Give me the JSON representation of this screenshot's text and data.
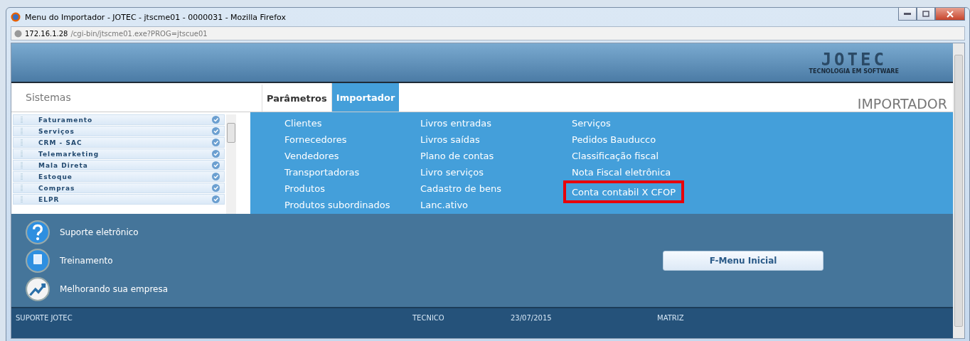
{
  "window": {
    "title": "Menu do Importador - JOTEC - jtscme01 - 0000031 - Mozilla Firefox"
  },
  "address": {
    "host": "172.16.1.28",
    "path": "/cgi-bin/jtscme01.exe?PROG=jtscue01"
  },
  "logo": {
    "name": "JOTEC",
    "tagline": "TECNOLOGIA EM SOFTWARE"
  },
  "sidebar": {
    "title": "Sistemas",
    "items": [
      {
        "label": "Faturamento"
      },
      {
        "label": "Serviços"
      },
      {
        "label": "CRM - SAC"
      },
      {
        "label": "Telemarketing"
      },
      {
        "label": "Mala Direta"
      },
      {
        "label": "Estoque"
      },
      {
        "label": "Compras"
      },
      {
        "label": "ELPR"
      }
    ]
  },
  "tabs": [
    {
      "label": "Parâmetros",
      "selected": false
    },
    {
      "label": "Importador",
      "selected": true
    }
  ],
  "page_title": "IMPORTADOR",
  "menu_columns": [
    [
      {
        "label": "Clientes",
        "highlighted": false
      },
      {
        "label": "Fornecedores",
        "highlighted": false
      },
      {
        "label": "Vendedores",
        "highlighted": false
      },
      {
        "label": "Transportadoras",
        "highlighted": false
      },
      {
        "label": "Produtos",
        "highlighted": false
      },
      {
        "label": "Produtos subordinados",
        "highlighted": false
      }
    ],
    [
      {
        "label": "Livros entradas",
        "highlighted": false
      },
      {
        "label": "Livros saídas",
        "highlighted": false
      },
      {
        "label": "Plano de contas",
        "highlighted": false
      },
      {
        "label": "Livro serviços",
        "highlighted": false
      },
      {
        "label": "Cadastro de bens",
        "highlighted": false
      },
      {
        "label": "Lanc.ativo",
        "highlighted": false
      }
    ],
    [
      {
        "label": "Serviços",
        "highlighted": false
      },
      {
        "label": "Pedidos Bauducco",
        "highlighted": false
      },
      {
        "label": "Classificação fiscal",
        "highlighted": false
      },
      {
        "label": "Nota Fiscal eletrônica",
        "highlighted": false
      },
      {
        "label": "Conta contabil X CFOP",
        "highlighted": true
      }
    ]
  ],
  "links": [
    {
      "kind": "help",
      "label": "Suporte eletrônico"
    },
    {
      "kind": "training",
      "label": "Treinamento"
    },
    {
      "kind": "growth",
      "label": "Melhorando sua empresa"
    }
  ],
  "home_button": "F-Menu Inicial",
  "status_bar": [
    "SUPORTE JOTEC",
    "TECNICO",
    "23/07/2015",
    "MATRIZ"
  ]
}
